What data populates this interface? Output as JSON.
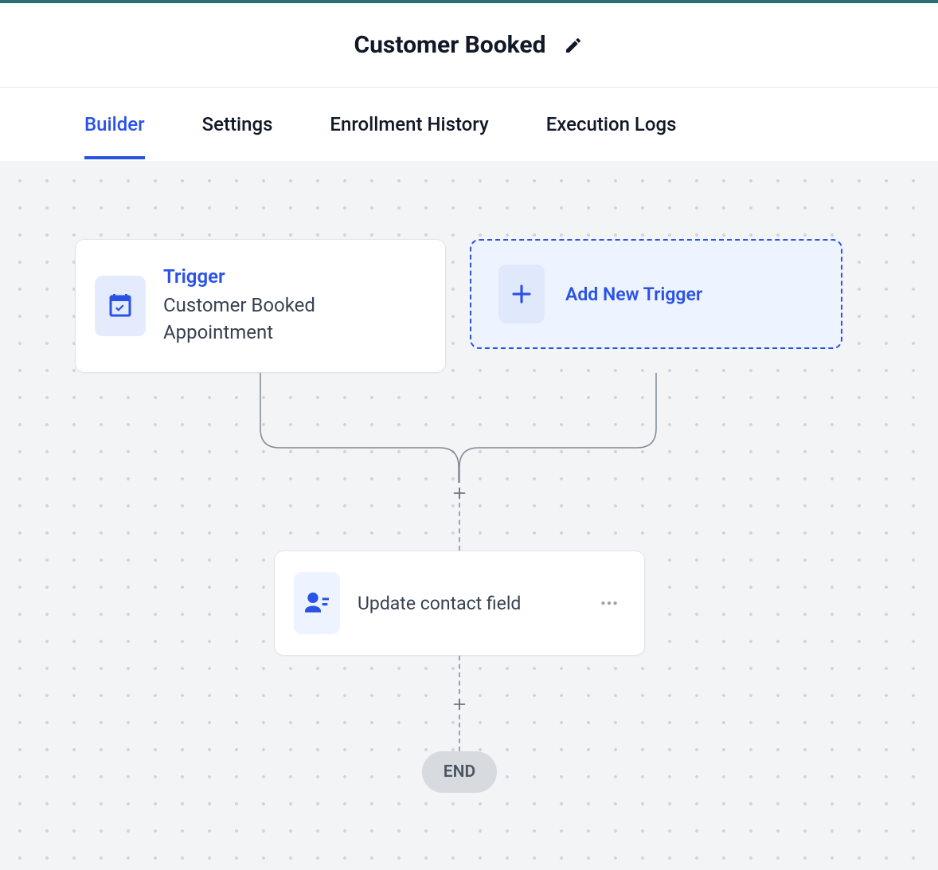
{
  "header": {
    "title": "Customer Booked"
  },
  "tabs": {
    "builder": "Builder",
    "settings": "Settings",
    "enrollment_history": "Enrollment History",
    "execution_logs": "Execution Logs"
  },
  "workflow": {
    "trigger": {
      "title": "Trigger",
      "description": "Customer Booked Appointment"
    },
    "add_trigger_label": "Add New Trigger",
    "action": {
      "label": "Update contact field"
    },
    "end_label": "END"
  }
}
